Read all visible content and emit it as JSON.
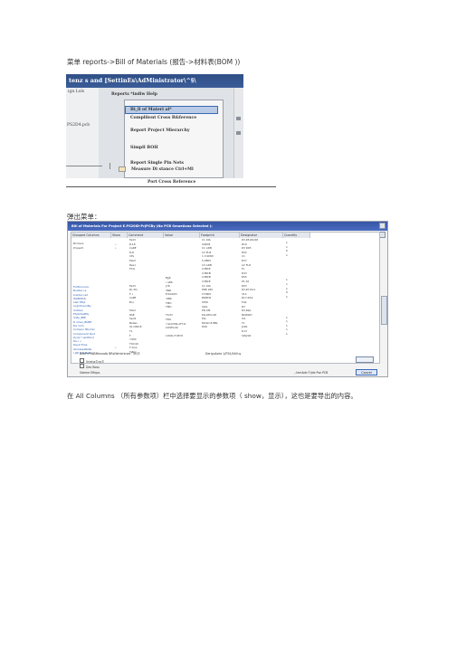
{
  "caption_top": "菜单 reports->Bill of Materials (报告->材料表(BOM ))",
  "menu_shot": {
    "title": "tenz s and    [SettinEs\\AdMinistrator\\^§\\",
    "left_labels": [
      "ign Lols",
      "PS2D4.pcb"
    ],
    "menubar": "Reports *indiw Help",
    "items": [
      "Bi_ll of Materi al*",
      "Compliient Cross R&ference",
      "Report Project Mierarchy",
      "Simpll BOH",
      "Report Single Pin Nets"
    ],
    "below_line1": "Measure Di stance Ctrl+Ml",
    "below_line2": "Port Cross Reference"
  },
  "caption_middle": "弹出菜单：",
  "dialog": {
    "title": "Bill of Materials For Project E.PS20ID-PrjPCBy (No PCB SmueAxax Selected ):",
    "headers": [
      "Grouped Columns",
      "Show",
      "Comment",
      "Value",
      "Footprint",
      "Designator",
      "Quantity"
    ],
    "col_group": "Bomsus\nProperti",
    "col_allcols": "FullDocume\nBuilder<a\nbuilder<a2\nISQBUt(5)\nLabi ER(L\nLogi/OverriBy\nlindiber\nPhotoSatMy\nlinRy_BPE\nD nlosu_BORE\nDe ririm\nCompon Ntumer\nComponent Kind\nZyrip^nentKind\nDe.i >\nDeyinTime\nIsCodeLeRetw\nI Jatl 1 DataM",
    "col_show": "\n•\n•\n\n\n\n\n\n\n\n\n\n\n\n\n\n\n\n\n\n\n\n\n\n\n\n•",
    "col_comment": "Fad3\nR-18\nCaRE\nR-R\nCtS\nFeb2\nRes1\nF0.IJ\n\n\n\nFad3\nRl--TcL\nF-l\nCaPE\nBol\n\nFeb2\nRSE\nSed2\nBelles\nIO-ONS B\nTL\nF\n74HC\nTOC40\nT-Ovp\nT-Bxp",
    "col_value": "BJJK\nr aPR\nJ7R\n3NR\nE!6ASDh\n'4BR\nTMD\nTMD\n\nTS.fO\nTRO\n!.SCLTON,ATT,R\nCOSELAR\n\n1OSD-IT-PI!M",
    "col_footprint": "C1 40L\n04408\nC1 ADB\nC2 PU4\n1.3.SMW\n5.0805\nC3 ADB\nC3BCE\nC3BCB\nC3BCB\nC3BCE\nC1 40L\nPKB 180\nI7C805\nBOBDS\nSHOI\nSOG\nPD-OB\nPLLOEC1LE\nPLL\nMOLD-E-8BL\nDWI",
    "col_designator": "R3,R5,R9,R8\nR10\nR3 R05\nR52\nC1\nR37\nA2 FLR\nFL\nR33\nR55\nP1 20\nR53\nR3,R7,R11\n313\nR17,R19\nFLN\nR3\nR3,R&L\nNCR6R7\nIC1\nT1\nJCR1\nD13\nSHJ202",
    "col_quantity": "1\n1\n0\n1\n\n\n\n\n\n1\n1\n1\n0\n1\n\n\n\n\n1\n1\n1\n1\n1",
    "footer_left": "BiIsP<•iNBMesnatb BRsIWmkrknes^3c)©",
    "footer_mid": "DeriguAcke 1/P20/44lfuy",
    "chk1": "Vrieha©es©",
    "chk2": "Dev Boss",
    "foot_bottom_left": "Sdeme   Effxpo.",
    "foot_bottom_right": "..!emAde F!jde Pse PCB",
    "cancel": "Cancel"
  },
  "caption_bottom": "在 All Columns （所有参数项）栏中选择要显示的参数项（      show，显示），这也是要导出的内容。"
}
